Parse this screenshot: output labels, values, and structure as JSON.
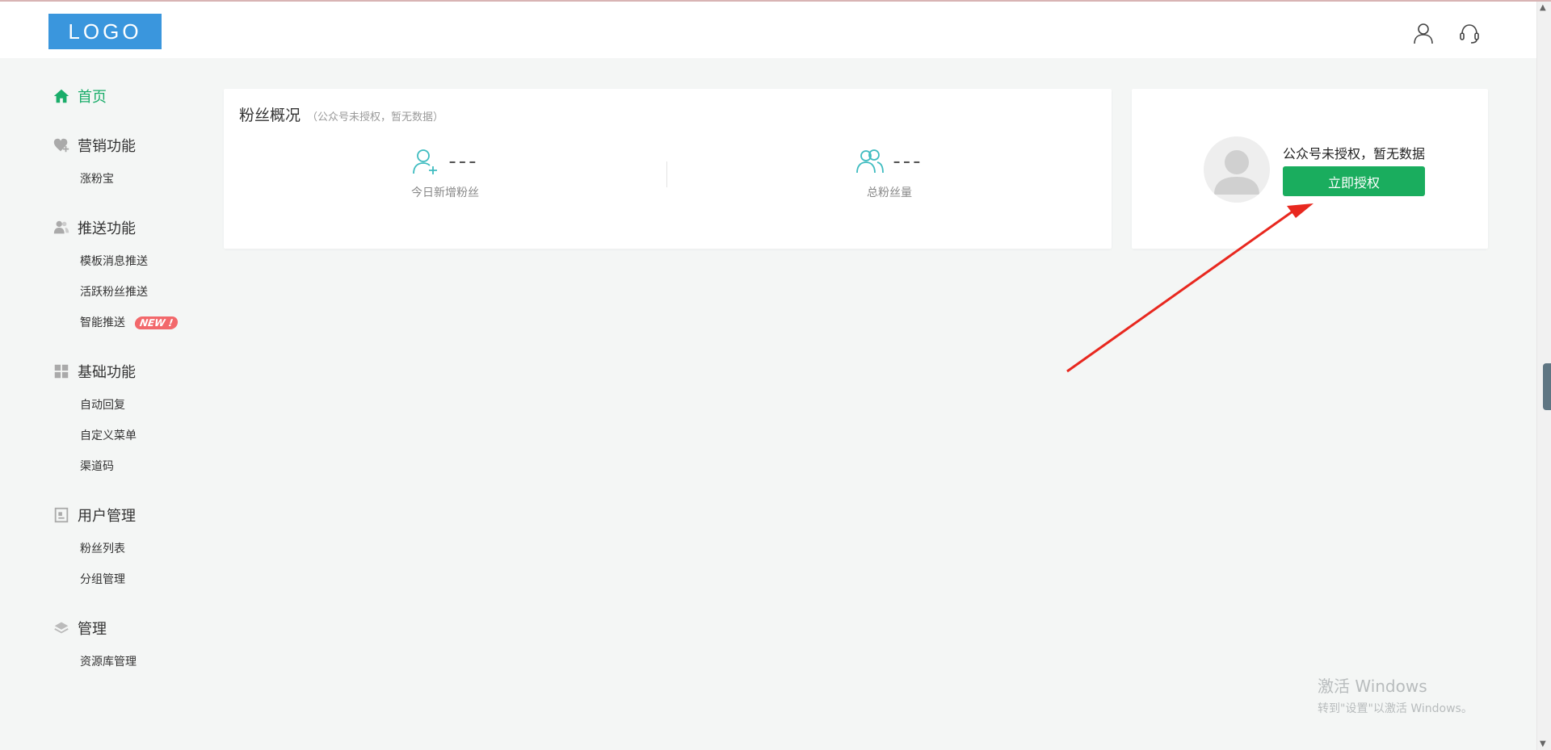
{
  "header": {
    "logo": "LOGO",
    "user_icon": "user-icon",
    "support_icon": "headset-icon"
  },
  "sidebar": {
    "home": "首页",
    "marketing": {
      "title": "营销功能",
      "items": [
        "涨粉宝"
      ]
    },
    "push": {
      "title": "推送功能",
      "items": [
        "模板消息推送",
        "活跃粉丝推送",
        "智能推送"
      ],
      "badge": "NEW !"
    },
    "basic": {
      "title": "基础功能",
      "items": [
        "自动回复",
        "自定义菜单",
        "渠道码"
      ]
    },
    "users": {
      "title": "用户管理",
      "items": [
        "粉丝列表",
        "分组管理"
      ]
    },
    "manage": {
      "title": "管理",
      "items": [
        "资源库管理"
      ]
    }
  },
  "fans_card": {
    "title": "粉丝概况",
    "subtitle": "（公众号未授权，暂无数据）",
    "today_new": {
      "value": "---",
      "label": "今日新增粉丝"
    },
    "total": {
      "value": "---",
      "label": "总粉丝量"
    }
  },
  "auth_card": {
    "message": "公众号未授权，暂无数据",
    "button": "立即授权"
  },
  "watermark": {
    "line1": "激活 Windows",
    "line2": "转到\"设置\"以激活 Windows。"
  },
  "colors": {
    "accent": "#1aad5e",
    "logo_bg": "#3a96dd",
    "annotation_arrow": "#e8281f",
    "badge": "#f2686b"
  }
}
